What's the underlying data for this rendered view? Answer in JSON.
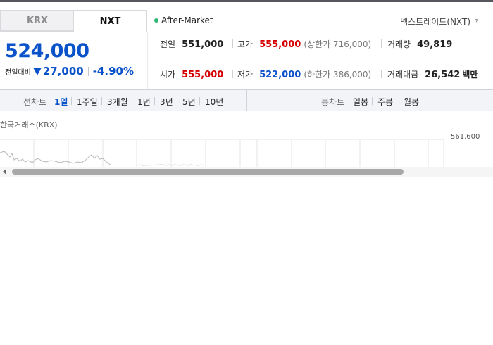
{
  "tabs": [
    {
      "label": "KRX",
      "active": false
    },
    {
      "label": "NXT",
      "active": true
    }
  ],
  "session": {
    "label": "After-Market",
    "dot_color": "#2bb673"
  },
  "nxt_help": {
    "label": "넥스트레이드(NXT)",
    "icon": "question-icon",
    "glyph": "?"
  },
  "price": {
    "current": "524,000",
    "change_label": "전일대비",
    "change": "27,000",
    "change_pct": "-4.90%",
    "direction_icon": "down-triangle-icon",
    "color": "#0a52c9"
  },
  "stats": {
    "prev_close": {
      "label": "전일",
      "value": "551,000"
    },
    "high": {
      "label": "고가",
      "value": "555,000",
      "sub": "(상한가 716,000)",
      "color": "#d60000"
    },
    "volume": {
      "label": "거래량",
      "value": "49,819"
    },
    "open": {
      "label": "시가",
      "value": "555,000",
      "color": "#d60000"
    },
    "low": {
      "label": "저가",
      "value": "522,000",
      "sub": "(하한가 386,000)",
      "color": "#0a52c9"
    },
    "amount": {
      "label": "거래대금",
      "value": "26,542",
      "unit": "백만"
    }
  },
  "toolbar": {
    "line_label": "선차트",
    "periods": [
      "1일",
      "1주일",
      "3개월",
      "1년",
      "3년",
      "5년",
      "10년"
    ],
    "selected_period": "1일",
    "candle_label": "봉차트",
    "candles": [
      "일봉",
      "주봉",
      "월봉"
    ]
  },
  "chart": {
    "exchange_label": "한국거래소(KRX)",
    "y_top_label": "561,600"
  }
}
